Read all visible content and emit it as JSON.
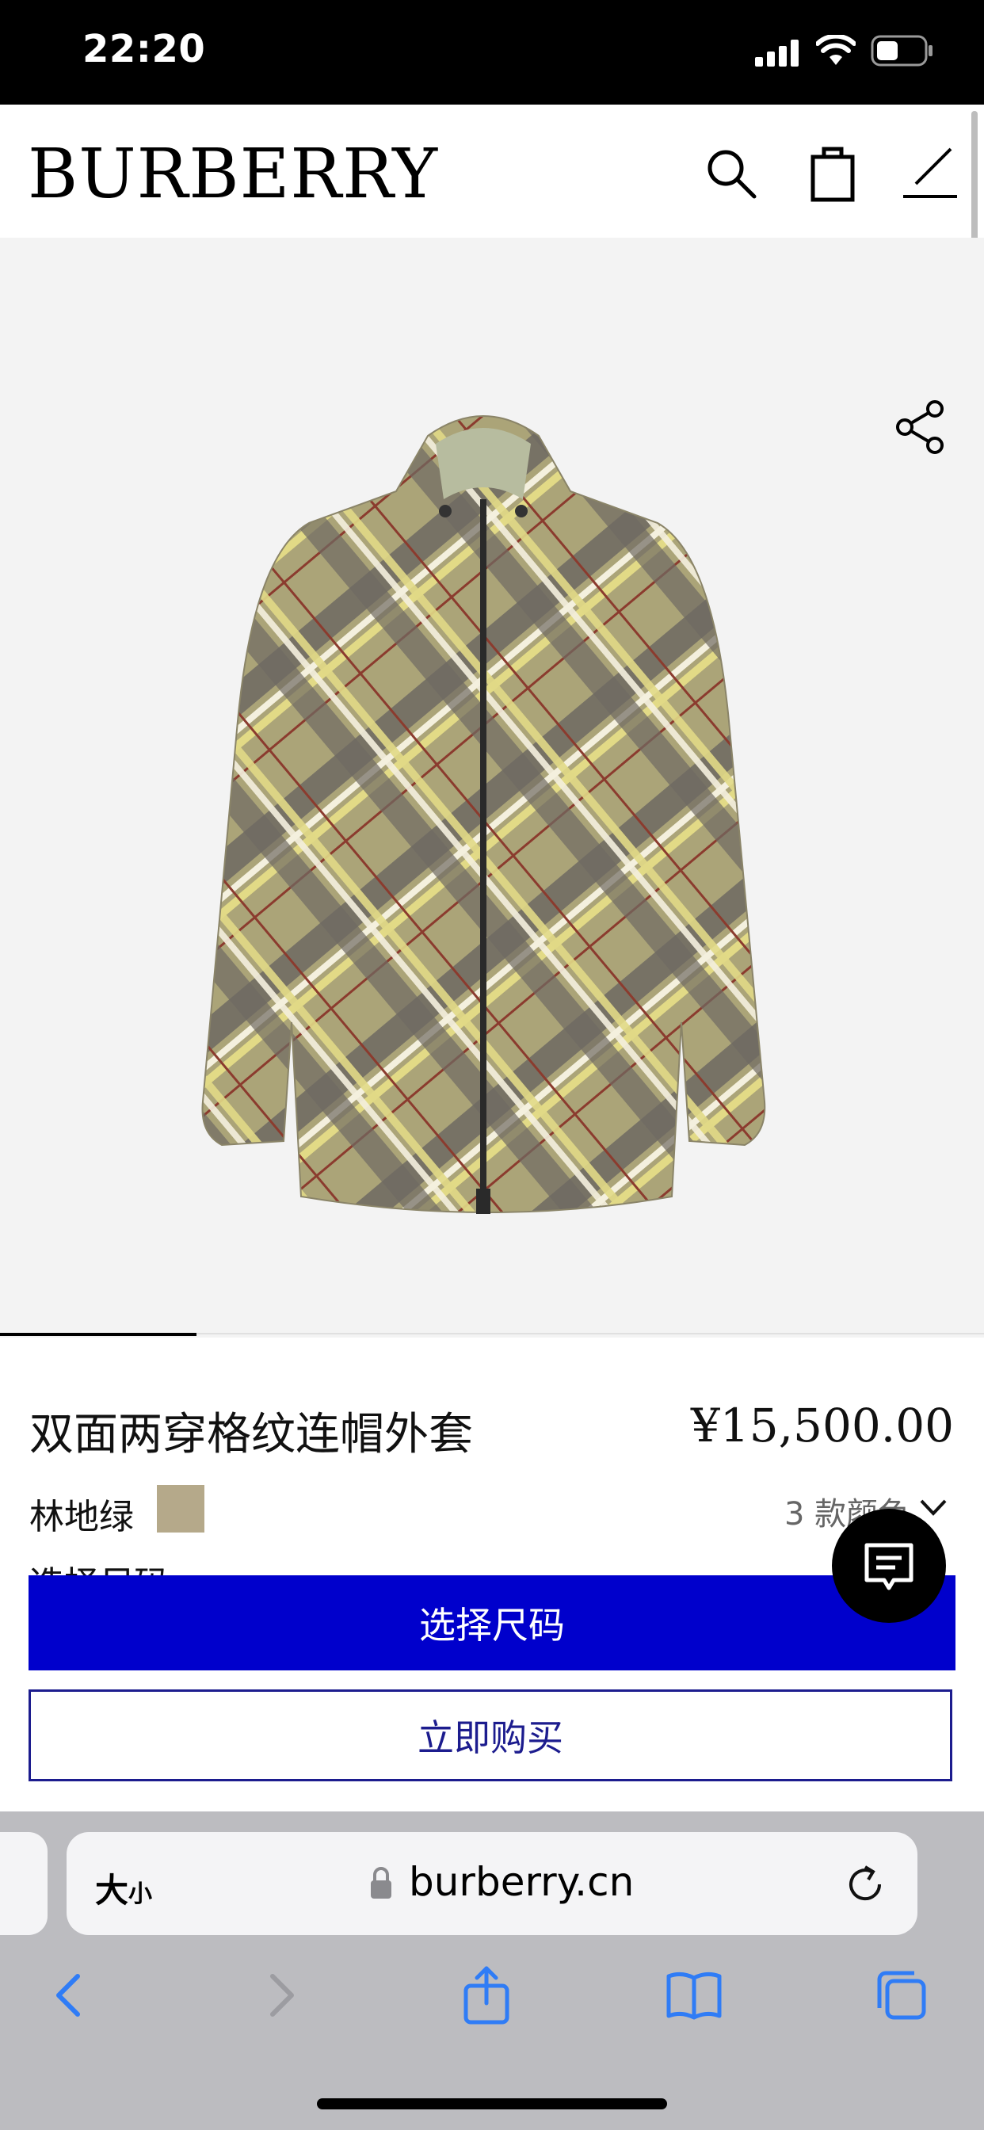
{
  "status_bar": {
    "time": "22:20"
  },
  "header": {
    "brand": "BURBERRY",
    "icons": [
      "search-icon",
      "shopping-bag-icon",
      "menu-icon"
    ]
  },
  "gallery": {
    "icons": [
      "share-icon"
    ],
    "progress": 0.2
  },
  "product": {
    "title": "双面两穿格纹连帽外套",
    "price": "¥15,500.00",
    "color_name": "林地绿",
    "color_hex": "#b5a98a",
    "colors_count": "3 款颜色",
    "size_prompt_partial": "选择尺码"
  },
  "actions": {
    "select_size": "选择尺码",
    "buy_now": "立即购买"
  },
  "safari": {
    "text_size_big": "大",
    "text_size_small": "小",
    "url": "burberry.cn",
    "toolbar_icons": [
      "back-icon",
      "forward-icon",
      "share-icon",
      "bookmarks-icon",
      "tabs-icon"
    ]
  },
  "colors": {
    "primary_button": "#0000cc",
    "outline_button": "#1c1c8e",
    "swatch": "#b5a98a"
  }
}
